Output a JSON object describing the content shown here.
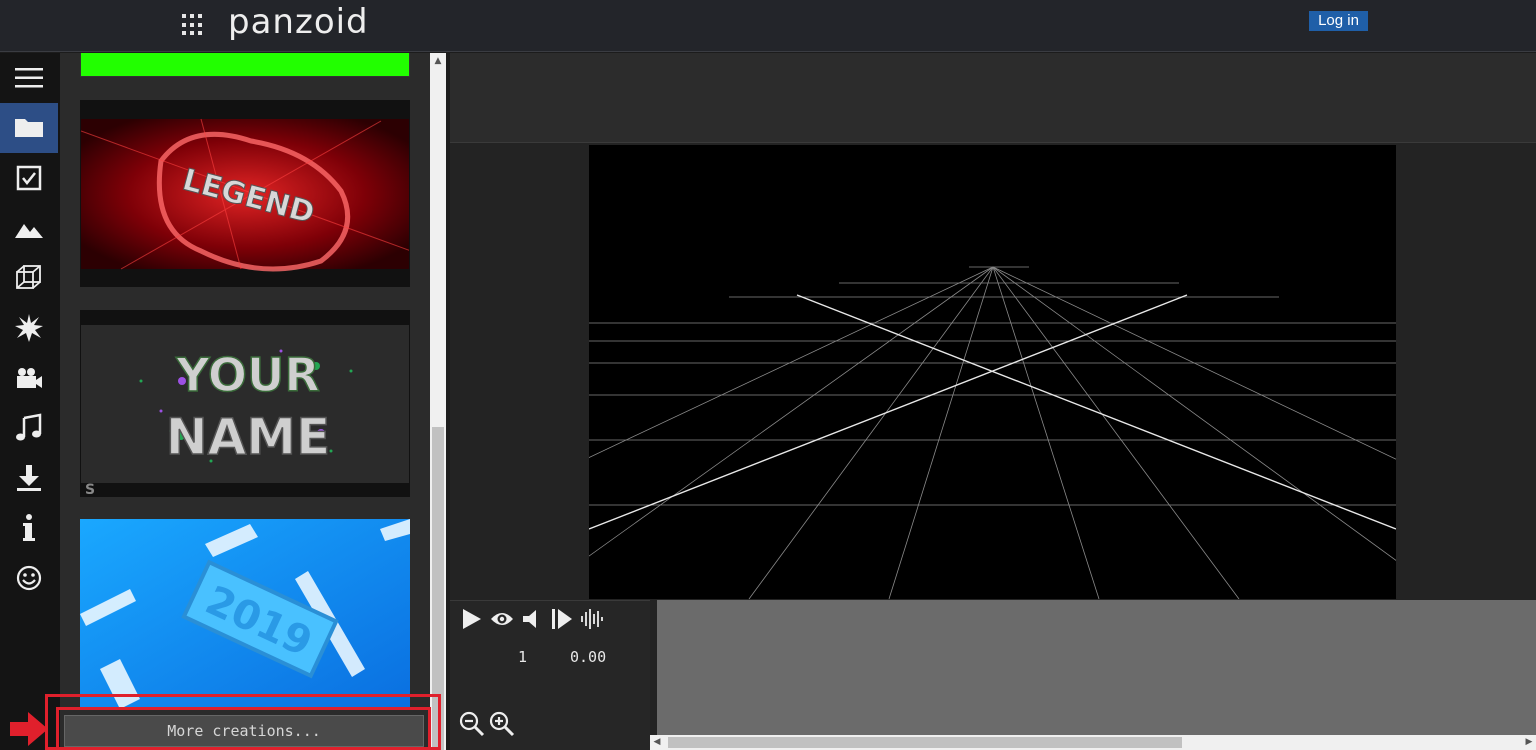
{
  "header": {
    "logo": "panzoid",
    "login_label": "Log in",
    "accent": "#1f5fa8"
  },
  "rail": {
    "items": [
      {
        "icon": "menu-icon"
      },
      {
        "icon": "folder-icon",
        "active": true
      },
      {
        "icon": "checkbox-icon"
      },
      {
        "icon": "image-icon"
      },
      {
        "icon": "cube-icon"
      },
      {
        "icon": "burst-icon"
      },
      {
        "icon": "video-camera-icon"
      },
      {
        "icon": "music-note-icon"
      },
      {
        "icon": "download-icon"
      },
      {
        "icon": "info-icon"
      },
      {
        "icon": "smiley-icon"
      }
    ]
  },
  "creations": {
    "thumbnails": [
      {
        "name": "green-screen",
        "color": "#22ff00"
      },
      {
        "name": "legend",
        "text": "LEGEND"
      },
      {
        "name": "your-name",
        "text_line1": "YOUR",
        "text_line2": "NAME",
        "corner": "S"
      },
      {
        "name": "2019",
        "text": "2019"
      }
    ],
    "more_label": "More creations..."
  },
  "playback": {
    "frame": "1",
    "time": "0.00"
  }
}
